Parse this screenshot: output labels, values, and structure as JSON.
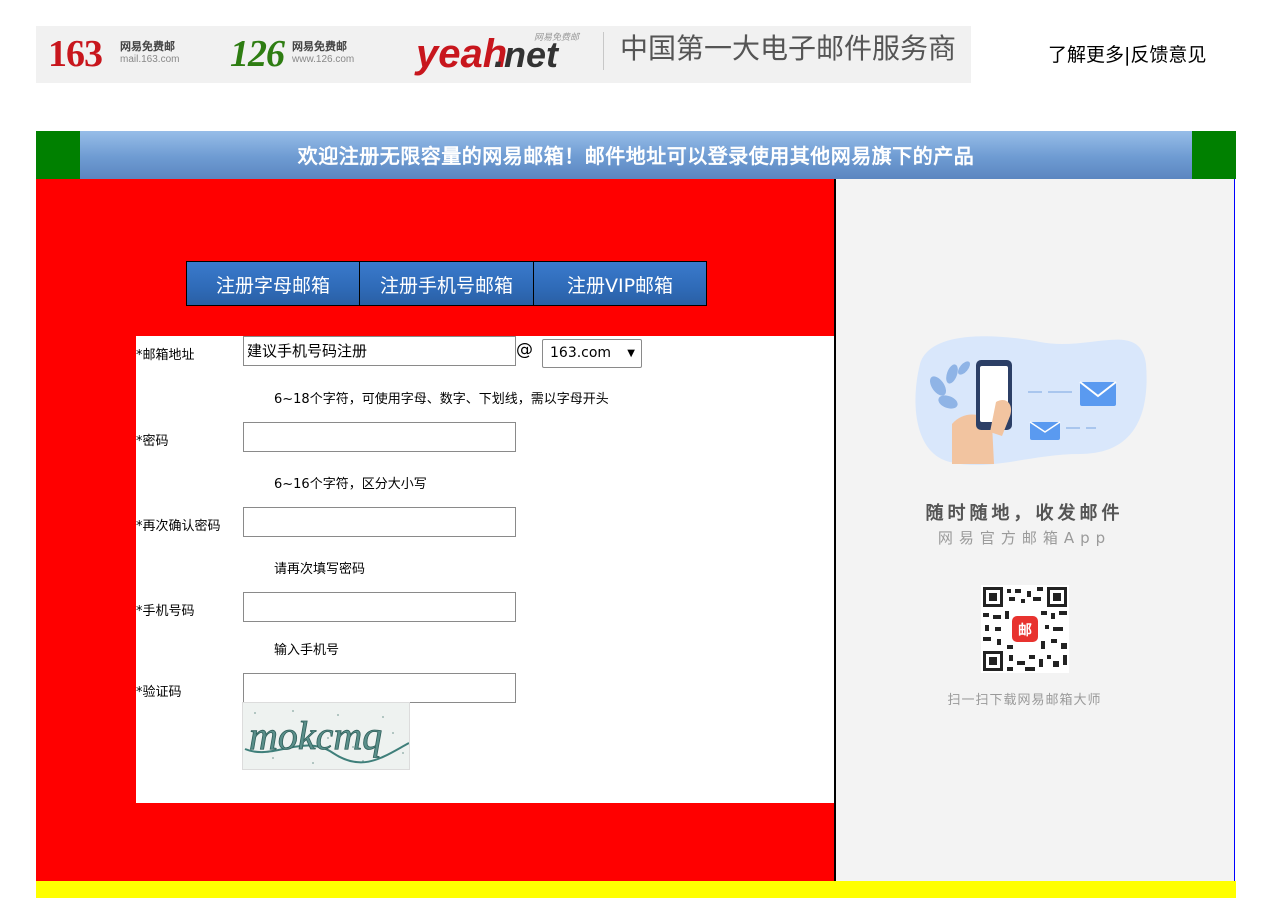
{
  "header": {
    "brands": [
      {
        "name": "163",
        "line1": "网易免费邮",
        "line2": "mail.163.com"
      },
      {
        "name": "126",
        "line1": "网易免费邮",
        "line2": "www.126.com"
      },
      {
        "name_a": "yeah",
        "name_b": ".net",
        "tag": "网易免费邮"
      }
    ],
    "slogan": "中国第一大电子邮件服务商",
    "links": {
      "learn_more": "了解更多",
      "separator": "|",
      "feedback": "反馈意见"
    }
  },
  "welcome": "欢迎注册无限容量的网易邮箱！邮件地址可以登录使用其他网易旗下的产品",
  "tabs": [
    {
      "label": "注册字母邮箱"
    },
    {
      "label": "注册手机号邮箱"
    },
    {
      "label": "注册VIP邮箱"
    }
  ],
  "form": {
    "email": {
      "label": "*邮箱地址",
      "placeholder": "建议手机号码注册",
      "at": "@",
      "domain": "163.com",
      "hint": "6~18个字符，可使用字母、数字、下划线，需以字母开头"
    },
    "password": {
      "label": "*密码",
      "hint": "6~16个字符，区分大小写"
    },
    "confirm": {
      "label": "*再次确认密码",
      "hint": "请再次填写密码"
    },
    "phone": {
      "label": "*手机号码",
      "hint": "输入手机号"
    },
    "captcha": {
      "label": "*验证码",
      "image_text": "mokcmq"
    }
  },
  "app_promo": {
    "title": "随时随地，收发邮件",
    "subtitle": "网易官方邮箱App",
    "qr_caption": "扫一扫下载网易邮箱大师",
    "qr_badge": "邮"
  },
  "colors": {
    "outer_frame": "#008000",
    "left_panel": "#ff0000",
    "right_panel": "#f3f3f3",
    "footer_strip": "#ffff00",
    "tab_blue": "#2f6bb8"
  }
}
